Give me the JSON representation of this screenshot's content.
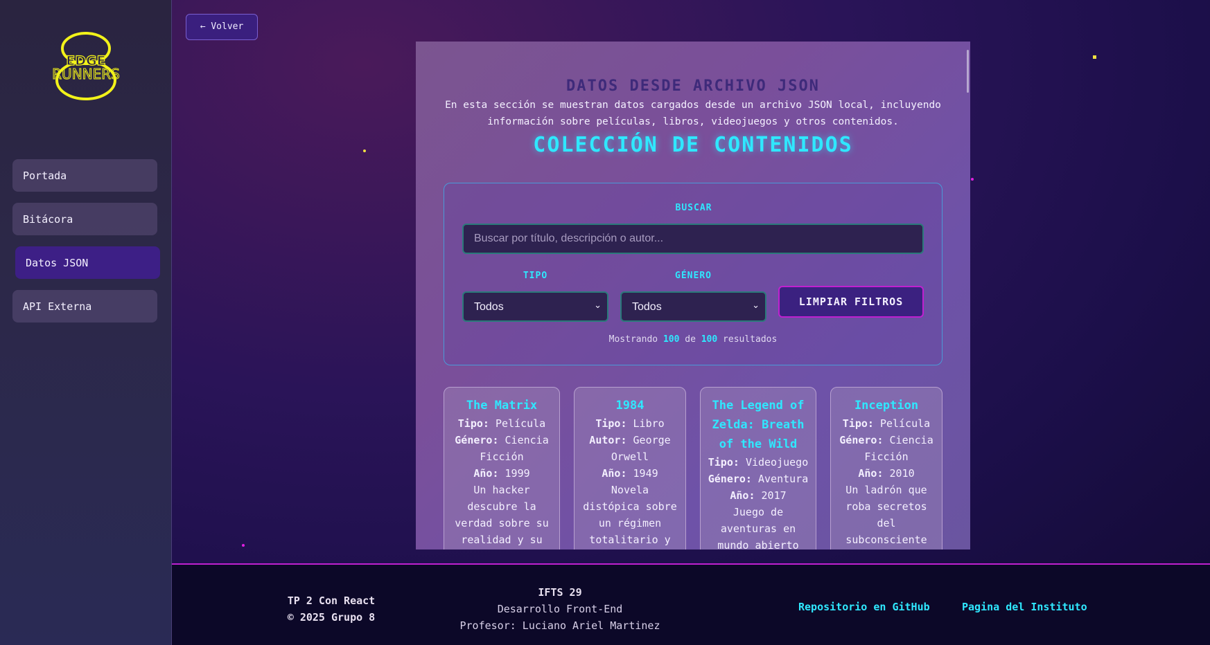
{
  "sidebar": {
    "logo_text_top": "EDGE",
    "logo_text_bottom": "RUNNERS",
    "items": [
      {
        "label": "Portada"
      },
      {
        "label": "Bitácora"
      },
      {
        "label": "Datos JSON"
      },
      {
        "label": "API Externa"
      }
    ]
  },
  "back_button": "← Volver",
  "panel": {
    "title": "DATOS DESDE ARCHIVO JSON",
    "description": "En esta sección se muestran datos cargados desde un archivo JSON local, incluyendo información sobre películas, libros, videojuegos y otros contenidos.",
    "collection_title": "COLECCIÓN DE CONTENIDOS"
  },
  "filters": {
    "search_label": "BUSCAR",
    "search_placeholder": "Buscar por título, descripción o autor...",
    "type_label": "TIPO",
    "type_value": "Todos",
    "genre_label": "GÉNERO",
    "genre_value": "Todos",
    "clear_button": "LIMPIAR FILTROS",
    "results_prefix": "Mostrando",
    "results_shown": "100",
    "results_mid": "de",
    "results_total": "100",
    "results_suffix": "resultados"
  },
  "cards": [
    {
      "title": "The Matrix",
      "fields": [
        {
          "key": "Tipo:",
          "value": "Película"
        },
        {
          "key": "Género:",
          "value": "Ciencia Ficción"
        },
        {
          "key": "Año:",
          "value": "1999"
        }
      ],
      "description": "Un hacker descubre la verdad sobre su realidad y su"
    },
    {
      "title": "1984",
      "fields": [
        {
          "key": "Tipo:",
          "value": "Libro"
        },
        {
          "key": "Autor:",
          "value": "George Orwell"
        },
        {
          "key": "Año:",
          "value": "1949"
        }
      ],
      "description": "Novela distópica sobre un régimen totalitario y la vigilancia"
    },
    {
      "title": "The Legend of Zelda: Breath of the Wild",
      "fields": [
        {
          "key": "Tipo:",
          "value": "Videojuego"
        },
        {
          "key": "Género:",
          "value": "Aventura"
        },
        {
          "key": "Año:",
          "value": "2017"
        }
      ],
      "description": "Juego de aventuras en mundo abierto con"
    },
    {
      "title": "Inception",
      "fields": [
        {
          "key": "Tipo:",
          "value": "Película"
        },
        {
          "key": "Género:",
          "value": "Ciencia Ficción"
        },
        {
          "key": "Año:",
          "value": "2010"
        }
      ],
      "description": "Un ladrón que roba secretos del subconsciente"
    }
  ],
  "footer": {
    "left_line1": "TP 2 Con React",
    "left_line2": "© 2025 Grupo 8",
    "center_line1": "IFTS 29",
    "center_line2": "Desarrollo Front-End",
    "center_line3": "Profesor: Luciano Ariel Martinez",
    "link_github": "Repositorio en GitHub",
    "link_institute": "Pagina del Instituto"
  },
  "colors": {
    "accent_cyan": "#2fe8ff",
    "accent_magenta": "#c020d0",
    "active_nav": "#3d1f86",
    "logo_yellow": "#f2f21a"
  }
}
